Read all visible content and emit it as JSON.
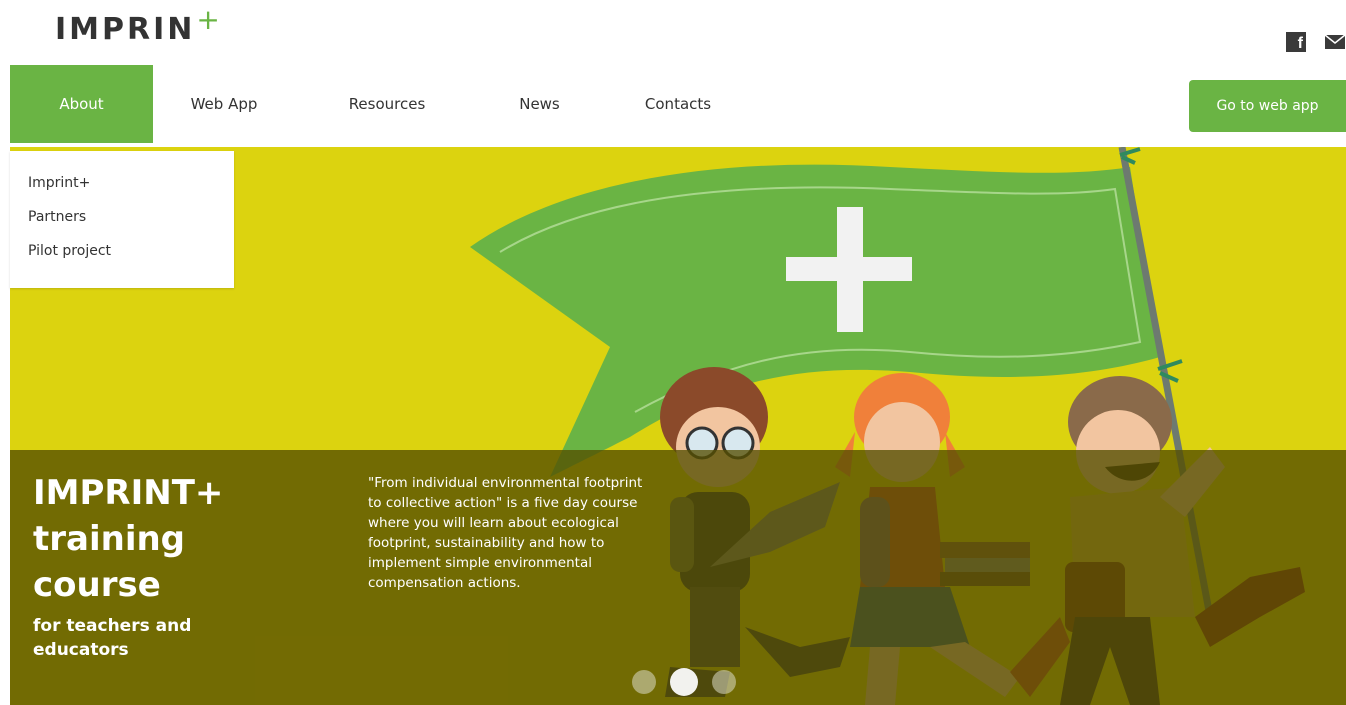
{
  "brand": {
    "name": "IMPRIN",
    "plus": "+"
  },
  "social": {
    "facebook_icon": "facebook-icon",
    "mail_icon": "mail-icon"
  },
  "nav": {
    "items": [
      {
        "label": "About",
        "active": true
      },
      {
        "label": "Web App"
      },
      {
        "label": "Resources"
      },
      {
        "label": "News"
      },
      {
        "label": "Contacts"
      }
    ],
    "cta_label": "Go to web app"
  },
  "dropdown": {
    "items": [
      {
        "label": "Imprint+"
      },
      {
        "label": "Partners"
      },
      {
        "label": "Pilot project"
      }
    ]
  },
  "hero": {
    "title_line1": "IMPRINT+",
    "title_line2": "training",
    "title_line3": "course",
    "subtitle": "for teachers and educators",
    "description": "\"From individual environmental footprint to collective action\" is a five day course where you will learn about ecological footprint, sustainability and how to implement simple environmental compensation actions.",
    "slides_total": 3,
    "slide_active": 2
  },
  "colors": {
    "accent": "#6ab444",
    "hero_bg": "#dcd30f",
    "band": "#554e00"
  }
}
